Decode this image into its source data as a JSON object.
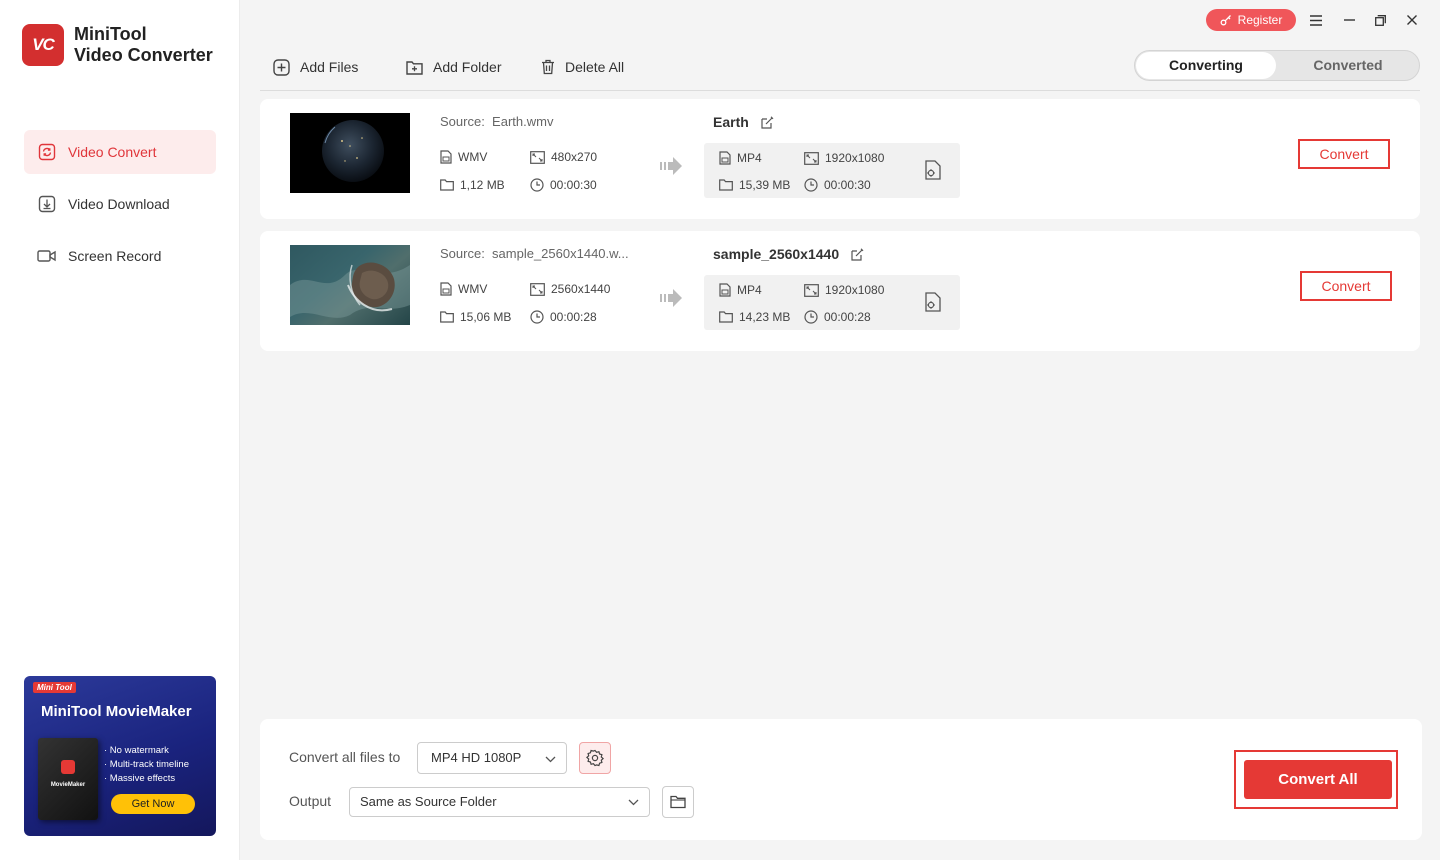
{
  "app": {
    "logo_text": "VC",
    "name_line1": "MiniTool",
    "name_line2": "Video Converter"
  },
  "sidebar": {
    "items": [
      {
        "label": "Video Convert",
        "icon": "convert-icon",
        "active": true
      },
      {
        "label": "Video Download",
        "icon": "download-icon",
        "active": false
      },
      {
        "label": "Screen Record",
        "icon": "camera-icon",
        "active": false
      }
    ]
  },
  "ad": {
    "badge": "Mini Tool",
    "title": "MiniTool MovieMaker",
    "box_name": "MovieMaker",
    "features": [
      "· No watermark",
      "· Multi-track timeline",
      "· Massive effects"
    ],
    "cta": "Get Now"
  },
  "titlebar": {
    "register_label": "Register"
  },
  "toolbar": {
    "add_files": "Add Files",
    "add_folder": "Add Folder",
    "delete_all": "Delete All"
  },
  "tabs": {
    "converting": "Converting",
    "converted": "Converted"
  },
  "files": [
    {
      "source_label": "Source:",
      "source_name": "Earth.wmv",
      "source_format": "WMV",
      "source_resolution": "480x270",
      "source_size": "1,12 MB",
      "source_duration": "00:00:30",
      "target_name": "Earth",
      "target_format": "MP4",
      "target_resolution": "1920x1080",
      "target_size": "15,39 MB",
      "target_duration": "00:00:30",
      "convert_label": "Convert"
    },
    {
      "source_label": "Source:",
      "source_name": "sample_2560x1440.w...",
      "source_format": "WMV",
      "source_resolution": "2560x1440",
      "source_size": "15,06 MB",
      "source_duration": "00:00:28",
      "target_name": "sample_2560x1440",
      "target_format": "MP4",
      "target_resolution": "1920x1080",
      "target_size": "14,23 MB",
      "target_duration": "00:00:28",
      "convert_label": "Convert"
    }
  ],
  "bottom": {
    "convert_all_to_label": "Convert all files to",
    "format_value": "MP4 HD 1080P",
    "output_label": "Output",
    "output_value": "Same as Source Folder",
    "convert_all_label": "Convert All"
  },
  "colors": {
    "accent": "#e53935",
    "active_nav_bg": "#fdecec",
    "register_bg": "#f0565a"
  }
}
